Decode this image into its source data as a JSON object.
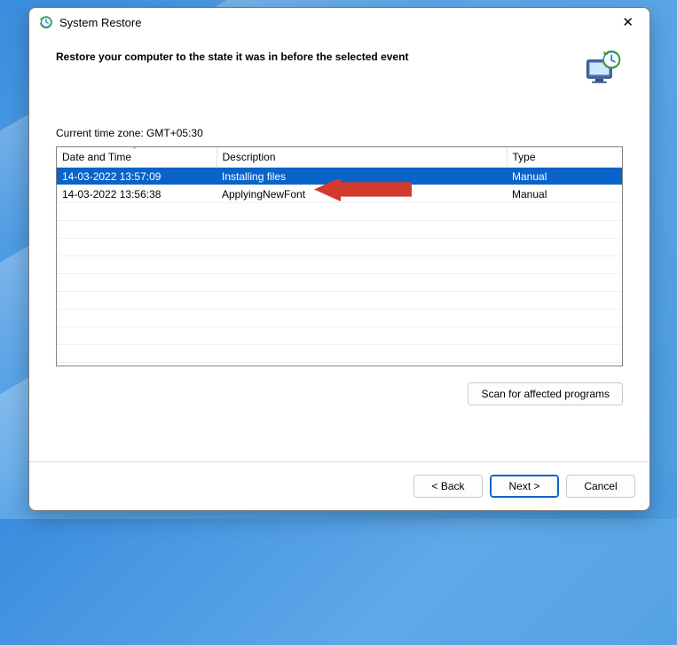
{
  "window": {
    "title": "System Restore",
    "heading": "Restore your computer to the state it was in before the selected event",
    "timezone_label": "Current time zone: GMT+05:30"
  },
  "table": {
    "columns": {
      "date": "Date and Time",
      "desc": "Description",
      "type": "Type"
    },
    "rows": [
      {
        "date": "14-03-2022 13:57:09",
        "desc": "Installing files",
        "type": "Manual",
        "selected": true
      },
      {
        "date": "14-03-2022 13:56:38",
        "desc": "ApplyingNewFont",
        "type": "Manual",
        "selected": false
      }
    ]
  },
  "buttons": {
    "scan": "Scan for affected programs",
    "back": "< Back",
    "next": "Next >",
    "cancel": "Cancel"
  }
}
